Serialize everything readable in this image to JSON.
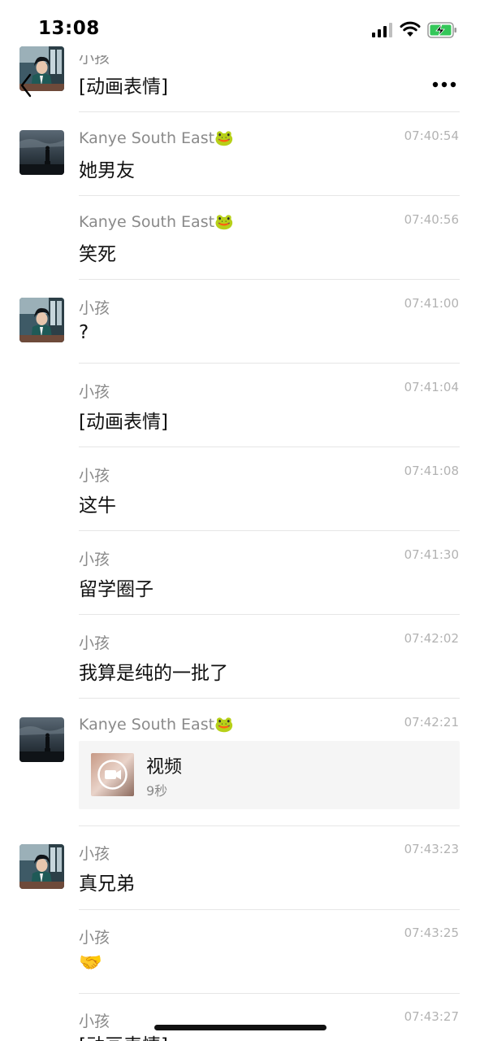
{
  "status_bar": {
    "time": "13:08"
  },
  "messages": [
    {
      "sender": "小孩",
      "time": "",
      "text": "[动画表情]",
      "avatar": "anime-boy"
    },
    {
      "sender": "Kanye South East🐸",
      "time": "07:40:54",
      "text": "她男友",
      "avatar": "dark-sky"
    },
    {
      "sender": "Kanye South East🐸",
      "time": "07:40:56",
      "text": "笑死"
    },
    {
      "sender": "小孩",
      "time": "07:41:00",
      "text": "?",
      "avatar": "anime-boy"
    },
    {
      "sender": "小孩",
      "time": "07:41:04",
      "text": "[动画表情]"
    },
    {
      "sender": "小孩",
      "time": "07:41:08",
      "text": "这牛"
    },
    {
      "sender": "小孩",
      "time": "07:41:30",
      "text": "留学圈子"
    },
    {
      "sender": "小孩",
      "time": "07:42:02",
      "text": "我算是纯的一批了"
    },
    {
      "sender": "Kanye South East🐸",
      "time": "07:42:21",
      "avatar": "dark-sky",
      "video": {
        "title": "视频",
        "duration": "9秒"
      }
    },
    {
      "sender": "小孩",
      "time": "07:43:23",
      "text": "真兄弟",
      "avatar": "anime-boy"
    },
    {
      "sender": "小孩",
      "time": "07:43:25",
      "text": "🤝"
    },
    {
      "sender": "小孩",
      "time": "07:43:27",
      "text": "[动画表情]"
    }
  ],
  "icons": {
    "back": "chevron-left-icon",
    "more": "more-dots-icon",
    "video": "video-camera-icon",
    "handshake": "handshake-emoji"
  }
}
